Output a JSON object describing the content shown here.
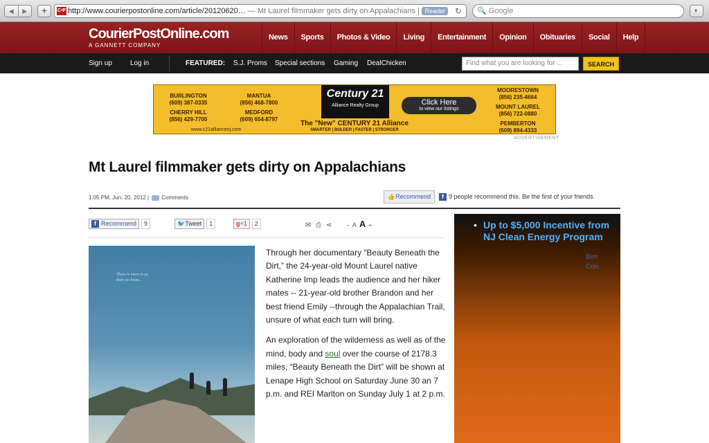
{
  "browser": {
    "url": "http://www.courierpostonline.com/article/20120620…",
    "page_title": " — Mt Laurel filmmaker gets dirty on Appalachians | Couri…",
    "reader_label": "Reader",
    "search_placeholder": "Google",
    "back_glyph": "◀",
    "forward_glyph": "▶",
    "favicon_text": "C•P"
  },
  "site": {
    "logo": "CourierPostOnline.com",
    "logo_sub": "A GANNETT COMPANY",
    "nav": [
      "News",
      "Sports",
      "Photos & Video",
      "Living",
      "Entertainment",
      "Opinion",
      "Obituaries",
      "Social",
      "Help"
    ],
    "subnav": {
      "signup": "Sign up",
      "login": "Log in",
      "featured_label": "FEATURED:",
      "featured": [
        "S.J. Proms",
        "Special sections",
        "Gaming",
        "DealChicken"
      ]
    },
    "search": {
      "placeholder": "Find what you are looking for ...",
      "button": "SEARCH"
    }
  },
  "ad_banner": {
    "offices_left": [
      {
        "name": "BURLINGTON",
        "phone": "(609) 387-0335"
      },
      {
        "name": "MANTUA",
        "phone": "(856) 468-7800"
      },
      {
        "name": "CHERRY HILL",
        "phone": "(856) 429-7700"
      },
      {
        "name": "MEDFORD",
        "phone": "(609) 654-8797"
      }
    ],
    "offices_right": [
      {
        "name": "MOORESTOWN",
        "phone": "(856) 235-4664"
      },
      {
        "name": "MOUNT LAUREL",
        "phone": "(856) 722-0880"
      },
      {
        "name": "PEMBERTON",
        "phone": "(609) 894-4333"
      }
    ],
    "brand": "Century 21",
    "brand_sub": "Alliance Realty Group",
    "cta": "Click Here",
    "cta_sub": "to view our listings",
    "tagline": "The \"New\" CENTURY 21 Alliance",
    "tagline_sub": "SMARTER | BOLDER | FASTER | STRONGER",
    "website": "www.c21alliancenj.com",
    "label": "ADVERTISEMENT"
  },
  "article": {
    "headline": "Mt Laurel filmmaker gets dirty on Appalachians",
    "timestamp": "1:05 PM, Jun. 20, 2012",
    "separator": "|",
    "comments": "Comments",
    "fb_recommend": "Recommend",
    "fb_text": "9 people recommend this. Be the first of your friends.",
    "share": {
      "fb_label": "Recommend",
      "fb_count": "9",
      "tw_label": "Tweet",
      "tw_count": "1",
      "gplus_label": "+1",
      "gplus_count": "2"
    },
    "tools": {
      "email": "✉",
      "print": "⎙",
      "share": "⋖",
      "text_small": "−",
      "text_a_small": "A",
      "text_a_large": "A",
      "text_larger": "+"
    },
    "photo_caption": "There is more to us\nthan we know...",
    "paragraphs": [
      "Through her documentary “Beauty Beneath the Dirt,” the 24-year-old Mount Laurel native Katherine Imp leads the audience and her hiker mates -- 21-year-old brother Brandon and her best friend Emily --through the Appalachian Trail, unsure of what each turn will bring."
    ],
    "para2": {
      "before": "An exploration of the wilderness as well as of the mind, body and ",
      "link": "soul",
      "after": " over the course of 2178.3 miles, “Beauty Beneath the Dirt” will be shown at Lenape High School on Saturday June 30 an 7 p.m. and REI Marlton on Sunday July 1 at 2 p.m."
    }
  },
  "side_ad": {
    "bullet": "•",
    "line1": "Up to $5,000 Incentive from",
    "line2": "NJ Clean Energy Program",
    "ghost": "Ben\nCon"
  },
  "colors": {
    "masthead": "#8e1d1d",
    "search_button": "#f3c21b",
    "ad_bg": "#f4bd2c",
    "link_green": "#2a6e2a"
  }
}
